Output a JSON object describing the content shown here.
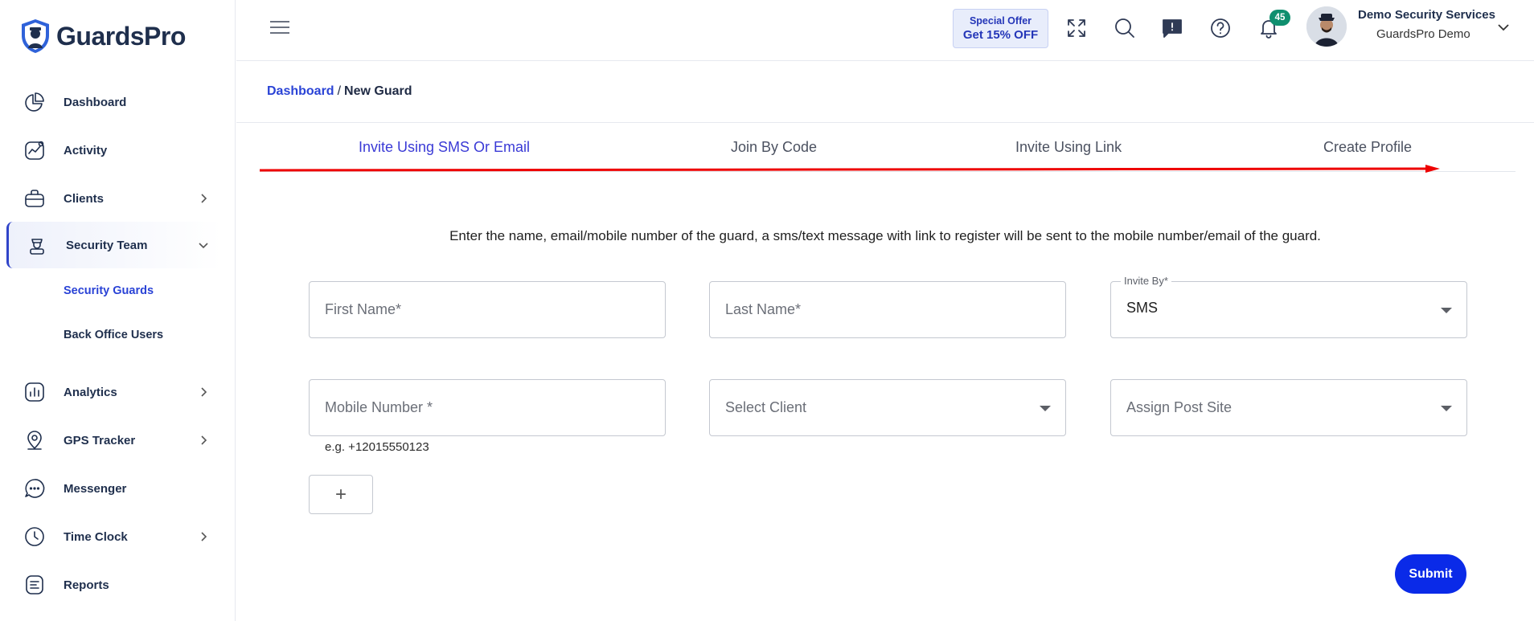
{
  "brand": {
    "name_part1": "Guards",
    "name_part2": "Pro"
  },
  "sidebar": {
    "items": [
      {
        "label": "Dashboard",
        "icon": "pie-chart-icon"
      },
      {
        "label": "Activity",
        "icon": "activity-icon"
      },
      {
        "label": "Clients",
        "icon": "briefcase-icon",
        "has_children": true
      },
      {
        "label": "Security Team",
        "icon": "guard-icon",
        "expanded": true
      },
      {
        "label": "Analytics",
        "icon": "bar-chart-icon",
        "has_children": true
      },
      {
        "label": "GPS Tracker",
        "icon": "location-pin-icon",
        "has_children": true
      },
      {
        "label": "Messenger",
        "icon": "chat-bubble-icon"
      },
      {
        "label": "Time Clock",
        "icon": "clock-icon",
        "has_children": true
      },
      {
        "label": "Reports",
        "icon": "document-icon"
      }
    ],
    "subitems": [
      {
        "label": "Security Guards",
        "active": true
      },
      {
        "label": "Back Office Users",
        "active": false
      }
    ]
  },
  "header": {
    "offer_line1": "Special Offer",
    "offer_line2": "Get 15% OFF",
    "notification_count": "45",
    "user_name": "Demo Security Services",
    "user_org": "GuardsPro Demo"
  },
  "breadcrumb": {
    "root": "Dashboard",
    "separator": "/",
    "current": "New Guard"
  },
  "tabs": [
    {
      "label": "Invite Using SMS Or Email",
      "active": true
    },
    {
      "label": "Join By Code",
      "active": false
    },
    {
      "label": "Invite Using Link",
      "active": false
    },
    {
      "label": "Create Profile",
      "active": false
    }
  ],
  "form": {
    "intro": "Enter the name, email/mobile number of the guard, a sms/text message with link to register will be sent to the mobile number/email of the guard.",
    "first_name_placeholder": "First Name*",
    "last_name_placeholder": "Last Name*",
    "invite_by_label": "Invite By*",
    "invite_by_value": "SMS",
    "mobile_placeholder": "Mobile Number *",
    "mobile_hint": "e.g. +12015550123",
    "client_placeholder": "Select Client",
    "post_site_placeholder": "Assign Post Site",
    "add_label": "+",
    "submit_label": "Submit"
  },
  "colors": {
    "accent": "#2a43d6",
    "submit": "#0a2ae8",
    "badge": "#0f8f6f",
    "annotation_arrow": "#ee0000"
  }
}
